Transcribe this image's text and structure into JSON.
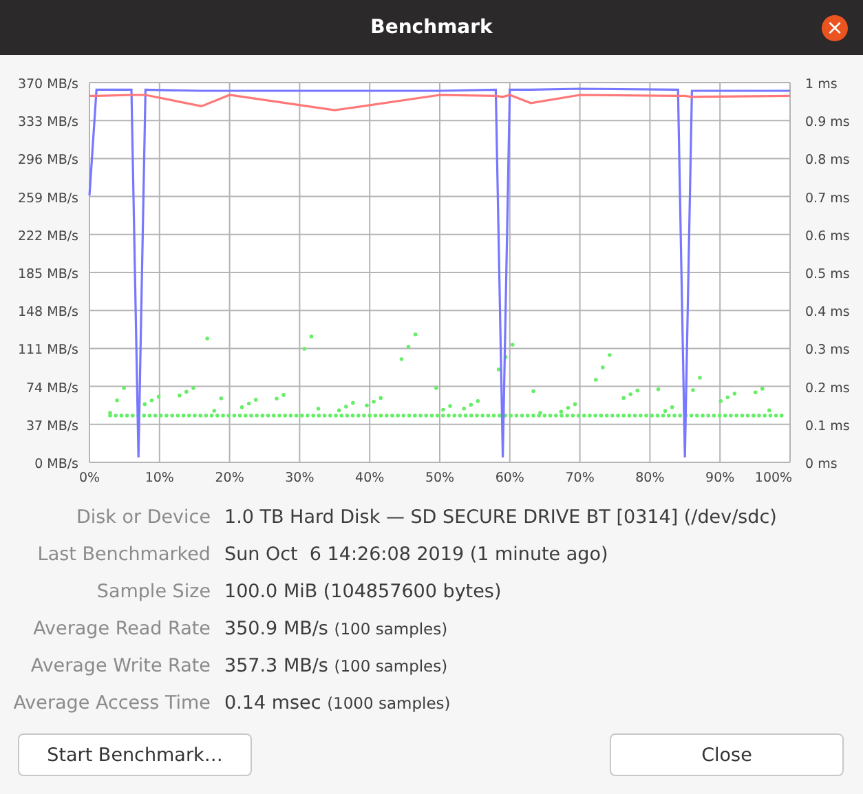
{
  "window": {
    "title": "Benchmark",
    "close_symbol": "×"
  },
  "chart": {
    "chart_data": {
      "type": "line",
      "x": [
        0,
        1,
        6,
        7,
        8,
        16,
        20,
        35,
        50,
        58,
        59,
        60,
        63,
        70,
        84,
        85,
        86,
        100
      ],
      "grid": true,
      "series": [
        {
          "color": "#7777ff",
          "values": [
            260,
            363,
            363,
            5,
            363,
            362,
            362,
            362,
            362,
            363,
            5,
            363,
            363,
            364,
            363,
            5,
            362,
            362
          ]
        },
        {
          "color": "#ff7777",
          "values": [
            357,
            357,
            358,
            358,
            358,
            347,
            358,
            343,
            358,
            357,
            356,
            358,
            350,
            358,
            357,
            357,
            356,
            357
          ]
        }
      ],
      "xlim": [
        0,
        100
      ],
      "ylim": [
        0,
        370
      ],
      "xticks": [
        {
          "value": 0,
          "label": "0%"
        },
        {
          "value": 10,
          "label": "10%"
        },
        {
          "value": 20,
          "label": "20%"
        },
        {
          "value": 30,
          "label": "30%"
        },
        {
          "value": 40,
          "label": "40%"
        },
        {
          "value": 50,
          "label": "50%"
        },
        {
          "value": 60,
          "label": "60%"
        },
        {
          "value": 70,
          "label": "70%"
        },
        {
          "value": 80,
          "label": "80%"
        },
        {
          "value": 90,
          "label": "90%"
        },
        {
          "value": 100,
          "label": "100%"
        }
      ],
      "yticks": [
        {
          "value": 0,
          "label": "0 MB/s"
        },
        {
          "value": 37,
          "label": "37 MB/s"
        },
        {
          "value": 74,
          "label": "74 MB/s"
        },
        {
          "value": 111,
          "label": "111 MB/s"
        },
        {
          "value": 148,
          "label": "148 MB/s"
        },
        {
          "value": 185,
          "label": "185 MB/s"
        },
        {
          "value": 222,
          "label": "222 MB/s"
        },
        {
          "value": 259,
          "label": "259 MB/s"
        },
        {
          "value": 296,
          "label": "296 MB/s"
        },
        {
          "value": 333,
          "label": "333 MB/s"
        },
        {
          "value": 370,
          "label": "370 MB/s"
        }
      ],
      "y2ticks": [
        "0 ms",
        "0.1 ms",
        "0.2 ms",
        "0.3 ms",
        "0.4 ms",
        "0.5 ms",
        "0.6 ms",
        "0.7 ms",
        "0.8 ms",
        "0.9 ms",
        "1 ms"
      ]
    }
  },
  "details": [
    {
      "label": "Disk or Device",
      "value": "1.0 TB Hard Disk — SD SECURE DRIVE BT [0314] (/dev/sdc)"
    },
    {
      "label": "Last Benchmarked",
      "value": "Sun Oct  6 14:26:08 2019 (1 minute ago)"
    },
    {
      "label": "Sample Size",
      "value": "100.0 MiB (104857600 bytes)"
    },
    {
      "label": "Average Read Rate",
      "value": "350.9 MB/s",
      "note": "(100 samples)"
    },
    {
      "label": "Average Write Rate",
      "value": "357.3 MB/s",
      "note": "(100 samples)"
    },
    {
      "label": "Average Access Time",
      "value": "0.14 msec",
      "note": "(1000 samples)"
    }
  ],
  "buttons": [
    "Start Benchmark…",
    "Close"
  ]
}
